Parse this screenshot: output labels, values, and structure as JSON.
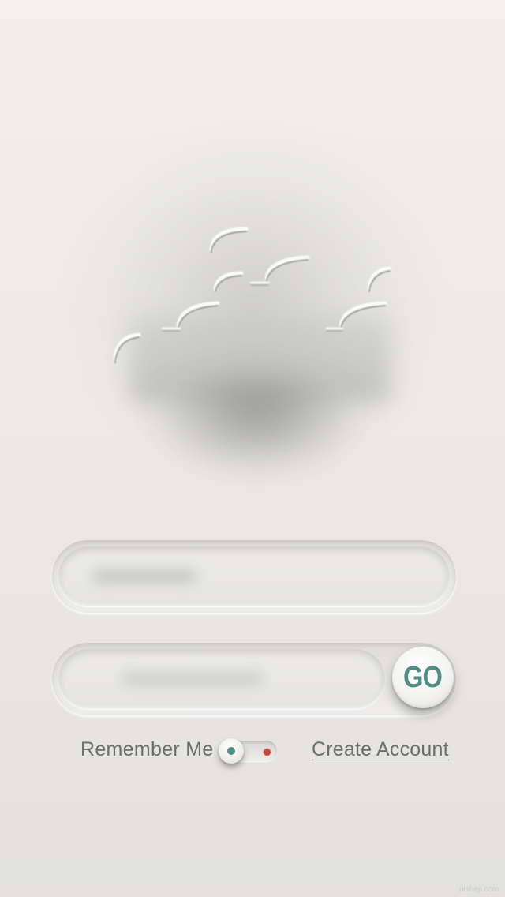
{
  "login": {
    "username_placeholder": "",
    "password_placeholder": "",
    "go_label": "GO",
    "remember_label": "Remember Me",
    "remember_on": false,
    "create_account_label": "Create Account"
  },
  "colors": {
    "accent": "#4f8d85",
    "toggle_off_dot": "#c9473a",
    "text": "#6d6d6b"
  },
  "watermark": "uisheji.com"
}
